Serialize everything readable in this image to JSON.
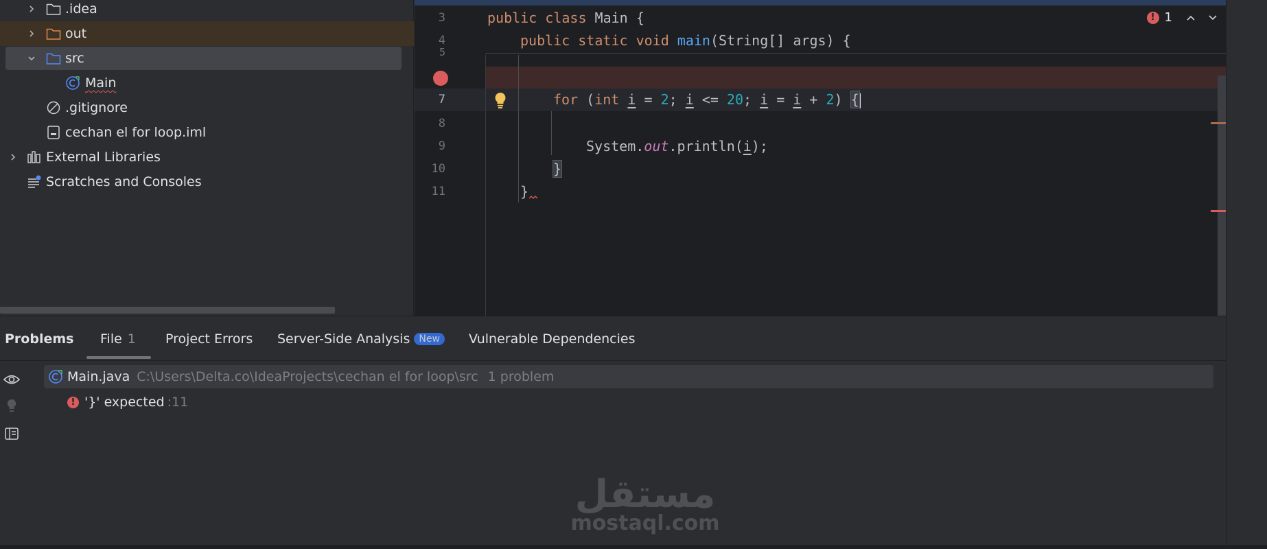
{
  "project_tree": {
    "items": [
      {
        "label": ".idea",
        "icon": "folder-icon"
      },
      {
        "label": "out",
        "icon": "folder-orange-icon"
      },
      {
        "label": "src",
        "icon": "folder-blue-icon"
      },
      {
        "label": "Main",
        "icon": "java-class-icon"
      },
      {
        "label": ".gitignore",
        "icon": "ignored-file-icon"
      },
      {
        "label": "cechan el  for loop.iml",
        "icon": "module-file-icon"
      },
      {
        "label": "External Libraries",
        "icon": "library-icon"
      },
      {
        "label": "Scratches and Consoles",
        "icon": "scratches-icon"
      }
    ]
  },
  "editor": {
    "line_numbers": [
      "3",
      "4",
      "5",
      "7",
      "8",
      "9",
      "10",
      "11"
    ],
    "code": {
      "l3_kw": "public class",
      "l3_rest": " Main {",
      "l4_kw": "public static void",
      "l4_fn": "main",
      "l4_rest": "(String[] args) {",
      "l7_for": "for",
      "l7_open": " (",
      "l7_int": "int",
      "l7_i1": "i",
      "l7_eq": " = ",
      "l7_n2": "2",
      "l7_semi": "; ",
      "l7_i2": "i",
      "l7_le": " <= ",
      "l7_n20": "20",
      "l7_semi2": "; ",
      "l7_i3": "i",
      "l7_eq2": " = ",
      "l7_i4": "i",
      "l7_plus": " + ",
      "l7_n2b": "2",
      "l7_close": ") ",
      "l7_brace": "{",
      "l9_sys": "System.",
      "l9_out": "out",
      "l9_println": ".println(",
      "l9_i": "i",
      "l9_end": ");",
      "l10_brace": "}",
      "l11_brace": "}"
    },
    "inspection_count": "1"
  },
  "problems": {
    "tabs": [
      {
        "label": "Problems"
      },
      {
        "label": "File",
        "count": "1"
      },
      {
        "label": "Project Errors"
      },
      {
        "label": "Server-Side Analysis",
        "badge": "New"
      },
      {
        "label": "Vulnerable Dependencies"
      }
    ],
    "file": {
      "name": "Main.java",
      "path": "C:\\Users\\Delta.co\\IdeaProjects\\cechan el  for loop\\src",
      "problem_count": "1 problem"
    },
    "issue": {
      "message": "'}' expected",
      "location": ":11"
    }
  },
  "watermark": {
    "arabic": "مستقل",
    "latin": "mostaql.com"
  },
  "colors": {
    "error": "#db5c5c",
    "keyword": "#cf8e6d",
    "function": "#56a8f5",
    "number": "#2aacb8",
    "accent": "#3574f0"
  }
}
